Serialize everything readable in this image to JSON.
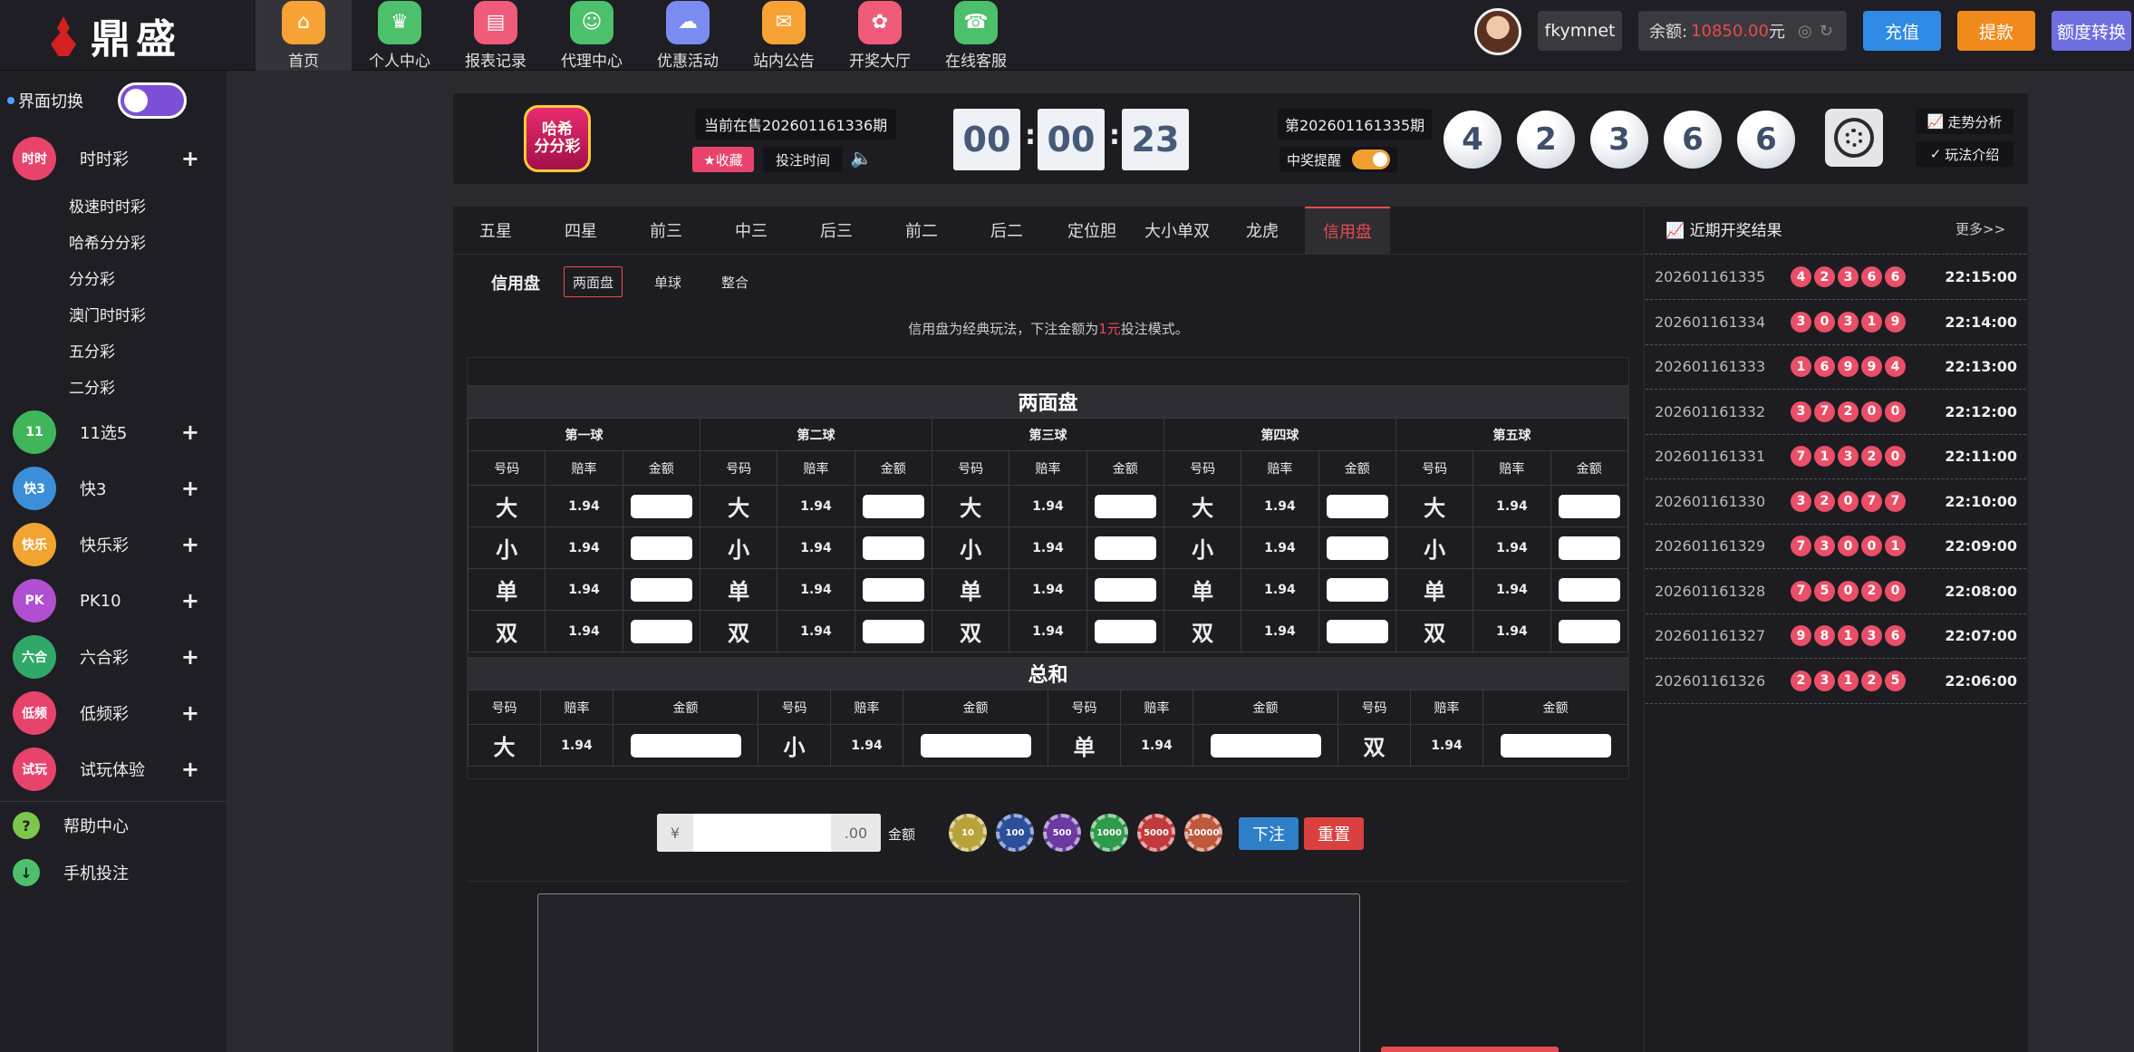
{
  "brand": {
    "name": "鼎盛"
  },
  "nav": [
    {
      "label": "首页",
      "icon": "home-icon",
      "color": "#f7a234"
    },
    {
      "label": "个人中心",
      "icon": "crown-icon",
      "color": "#4cc06b"
    },
    {
      "label": "报表记录",
      "icon": "report-icon",
      "color": "#ef5b78"
    },
    {
      "label": "代理中心",
      "icon": "agent-icon",
      "color": "#4cc06b"
    },
    {
      "label": "优惠活动",
      "icon": "gift-cloud-icon",
      "color": "#7b8cf0"
    },
    {
      "label": "站内公告",
      "icon": "mail-icon",
      "color": "#f7a234"
    },
    {
      "label": "开奖大厅",
      "icon": "grid-icon",
      "color": "#ef5b78"
    },
    {
      "label": "在线客服",
      "icon": "support-icon",
      "color": "#4cc06b"
    }
  ],
  "user": {
    "name": "fkymnet",
    "balance_label": "余额:",
    "balance_value": "10850.00",
    "currency": "元"
  },
  "top_buttons": {
    "recharge": "充值",
    "withdraw": "提款",
    "quota": "额度转换"
  },
  "sidebar": {
    "switch_label": "界面切换",
    "categories": [
      {
        "label": "时时彩",
        "icon_text": "时时",
        "color": "#e8436b"
      },
      {
        "label": "11选5",
        "icon_text": "11",
        "color": "#3fb65a"
      },
      {
        "label": "快3",
        "icon_text": "快3",
        "color": "#3a8fd8"
      },
      {
        "label": "快乐彩",
        "icon_text": "快乐",
        "color": "#f2a431"
      },
      {
        "label": "PK10",
        "icon_text": "PK",
        "color": "#b04fd0"
      },
      {
        "label": "六合彩",
        "icon_text": "六合",
        "color": "#2fa86a"
      },
      {
        "label": "低频彩",
        "icon_text": "低频",
        "color": "#e8436b"
      },
      {
        "label": "试玩体验",
        "icon_text": "试玩",
        "color": "#e8436b"
      }
    ],
    "sub_items": [
      "极速时时彩",
      "哈希分分彩",
      "分分彩",
      "澳门时时彩",
      "五分彩",
      "二分彩"
    ],
    "misc": [
      {
        "label": "帮助中心",
        "icon": "help-icon",
        "glyph": "?",
        "color": "#7bc64b"
      },
      {
        "label": "手机投注",
        "icon": "download-icon",
        "glyph": "↓",
        "color": "#4cc06b"
      }
    ]
  },
  "game": {
    "logo_line1": "哈希",
    "logo_line2": "分分彩",
    "current_issue": "当前在售202601161336期",
    "fav_label": "★收藏",
    "bet_time_label": "投注时间",
    "countdown": [
      "00",
      "00",
      "23"
    ],
    "prev_issue": "第202601161335期",
    "remind_label": "中奖提醒",
    "draw_numbers": [
      "4",
      "2",
      "3",
      "6",
      "6"
    ],
    "trend_label": "走势分析",
    "rules_label": "玩法介绍"
  },
  "tabs": [
    "五星",
    "四星",
    "前三",
    "中三",
    "后三",
    "前二",
    "后二",
    "定位胆",
    "大小单双",
    "龙虎",
    "信用盘"
  ],
  "mode": {
    "title": "信用盘",
    "options": [
      "两面盘",
      "单球",
      "整合"
    ]
  },
  "desc": {
    "before": "信用盘为经典玩法，下注金额为",
    "highlight": "1元",
    "after": "投注模式。"
  },
  "board": {
    "title": "两面盘",
    "balls": [
      "第一球",
      "第二球",
      "第三球",
      "第四球",
      "第五球"
    ],
    "columns": [
      "号码",
      "赔率",
      "金额"
    ],
    "rows": [
      {
        "label": "大",
        "odds": "1.94"
      },
      {
        "label": "小",
        "odds": "1.94"
      },
      {
        "label": "单",
        "odds": "1.94"
      },
      {
        "label": "双",
        "odds": "1.94"
      }
    ],
    "sum_title": "总和",
    "sum_cells": [
      {
        "label": "大",
        "odds": "1.94"
      },
      {
        "label": "小",
        "odds": "1.94"
      },
      {
        "label": "单",
        "odds": "1.94"
      },
      {
        "label": "双",
        "odds": "1.94"
      }
    ]
  },
  "betbar": {
    "currency": "¥",
    "cents": ".00",
    "amount_label": "金额",
    "chips": [
      {
        "value": "10",
        "color": "#b8a23a"
      },
      {
        "value": "100",
        "color": "#2c4f9a"
      },
      {
        "value": "500",
        "color": "#6a3aa0"
      },
      {
        "value": "1000",
        "color": "#2f9a4a"
      },
      {
        "value": "5000",
        "color": "#c0393b"
      },
      {
        "value": "10000",
        "color": "#c0593b"
      }
    ],
    "submit": "下注",
    "reset": "重置"
  },
  "results": {
    "title": "近期开奖结果",
    "more": "更多>>",
    "rows": [
      {
        "issue": "202601161335",
        "nums": [
          "4",
          "2",
          "3",
          "6",
          "6"
        ],
        "time": "22:15:00"
      },
      {
        "issue": "202601161334",
        "nums": [
          "3",
          "0",
          "3",
          "1",
          "9"
        ],
        "time": "22:14:00"
      },
      {
        "issue": "202601161333",
        "nums": [
          "1",
          "6",
          "9",
          "9",
          "4"
        ],
        "time": "22:13:00"
      },
      {
        "issue": "202601161332",
        "nums": [
          "3",
          "7",
          "2",
          "0",
          "0"
        ],
        "time": "22:12:00"
      },
      {
        "issue": "202601161331",
        "nums": [
          "7",
          "1",
          "3",
          "2",
          "0"
        ],
        "time": "22:11:00"
      },
      {
        "issue": "202601161330",
        "nums": [
          "3",
          "2",
          "0",
          "7",
          "7"
        ],
        "time": "22:10:00"
      },
      {
        "issue": "202601161329",
        "nums": [
          "7",
          "3",
          "0",
          "0",
          "1"
        ],
        "time": "22:09:00"
      },
      {
        "issue": "202601161328",
        "nums": [
          "7",
          "5",
          "0",
          "2",
          "0"
        ],
        "time": "22:08:00"
      },
      {
        "issue": "202601161327",
        "nums": [
          "9",
          "8",
          "1",
          "3",
          "6"
        ],
        "time": "22:07:00"
      },
      {
        "issue": "202601161326",
        "nums": [
          "2",
          "3",
          "1",
          "2",
          "5"
        ],
        "time": "22:06:00"
      }
    ]
  }
}
